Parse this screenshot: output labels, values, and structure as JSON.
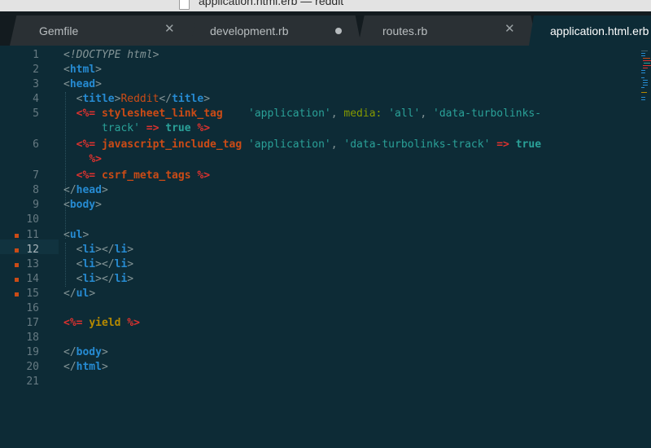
{
  "window": {
    "title": "application.html.erb — reddit"
  },
  "tabs": [
    {
      "label": "Gemfile",
      "state": "close"
    },
    {
      "label": "development.rb",
      "state": "dirty"
    },
    {
      "label": "routes.rb",
      "state": "close"
    },
    {
      "label": "application.html.erb",
      "state": "active"
    }
  ],
  "editor": {
    "current_line": 12,
    "line_numbers": [
      "1",
      "2",
      "3",
      "4",
      "5",
      "6",
      "7",
      "8",
      "9",
      "10",
      "11",
      "12",
      "13",
      "14",
      "15",
      "16",
      "17",
      "18",
      "19",
      "20",
      "21"
    ],
    "modified_lines": [
      11,
      12,
      13,
      14,
      15
    ],
    "code": {
      "l1": "<!DOCTYPE html>",
      "l2_tag": "html",
      "l3_tag": "head",
      "l4_open": "title",
      "l4_text": "Reddit",
      "l4_close": "title",
      "l5_erb_open": "<%=",
      "l5_method": "stylesheet_link_tag",
      "l5_arg1": "'application'",
      "l5_comma": ",",
      "l5_key": "media:",
      "l5_val": "'all'",
      "l5_key2": "'data-turbolinks-",
      "l5_cont": "track'",
      "l5_arrow": "=>",
      "l5_true": "true",
      "l5_erb_close": "%>",
      "l6_erb_open": "<%=",
      "l6_method": "javascript_include_tag",
      "l6_arg1": "'application'",
      "l6_key": "'data-turbolinks-track'",
      "l6_arrow": "=>",
      "l6_true": "true",
      "l6_erb_close": "%>",
      "l7_erb_open": "<%=",
      "l7_method": "csrf_meta_tags",
      "l7_erb_close": "%>",
      "l8_tag": "head",
      "l9_tag": "body",
      "l11_tag": "ul",
      "li_tag": "li",
      "l15_tag": "ul",
      "l17_erb_open": "<%=",
      "l17_method": "yield",
      "l17_erb_close": "%>",
      "l19_tag": "body",
      "l20_tag": "html"
    }
  },
  "colors": {
    "background": "#0d2b36",
    "tag": "#268bd2",
    "erb": "#dc322f",
    "method": "#cb4b16",
    "string": "#2aa198",
    "symbol": "#859900",
    "yield": "#b58900"
  }
}
